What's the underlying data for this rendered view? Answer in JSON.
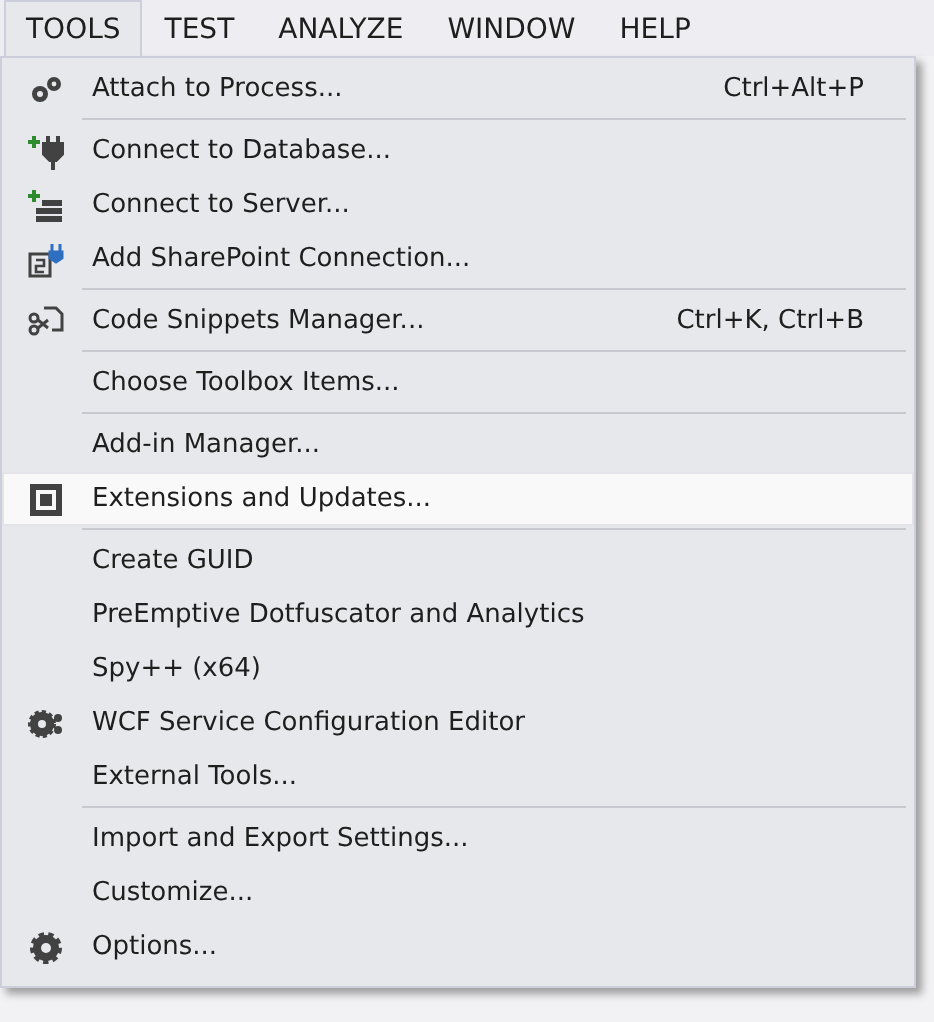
{
  "menu_bar": [
    {
      "label": "TOOLS",
      "selected": true
    },
    {
      "label": "TEST",
      "selected": false
    },
    {
      "label": "ANALYZE",
      "selected": false
    },
    {
      "label": "WINDOW",
      "selected": false
    },
    {
      "label": "HELP",
      "selected": false
    }
  ],
  "menu": {
    "groups": [
      [
        {
          "label": "Attach to Process...",
          "shortcut": "Ctrl+Alt+P",
          "kind": "gears",
          "selected": false
        }
      ],
      [
        {
          "label": "Connect to Database...",
          "kind": "plug",
          "selected": false
        },
        {
          "label": "Connect to Server...",
          "kind": "server",
          "selected": false
        },
        {
          "label": "Add SharePoint Connection...",
          "kind": "sharepoint",
          "selected": false
        }
      ],
      [
        {
          "label": "Code Snippets Manager...",
          "shortcut": "Ctrl+K, Ctrl+B",
          "kind": "snippet",
          "selected": false
        }
      ],
      [
        {
          "label": "Choose Toolbox Items...",
          "selected": false
        }
      ],
      [
        {
          "label": "Add-in Manager...",
          "selected": false
        },
        {
          "label": "Extensions and Updates...",
          "kind": "extensions",
          "selected": true
        }
      ],
      [
        {
          "label": "Create GUID",
          "selected": false
        },
        {
          "label": "PreEmptive Dotfuscator and Analytics",
          "selected": false
        },
        {
          "label": "Spy++ (x64)",
          "selected": false
        },
        {
          "label": "WCF Service Configuration Editor",
          "kind": "gearsmall",
          "selected": false
        },
        {
          "label": "External Tools...",
          "selected": false
        }
      ],
      [
        {
          "label": "Import and Export Settings...",
          "selected": false
        },
        {
          "label": "Customize...",
          "selected": false
        },
        {
          "label": "Options...",
          "kind": "gear",
          "selected": false
        }
      ]
    ]
  }
}
